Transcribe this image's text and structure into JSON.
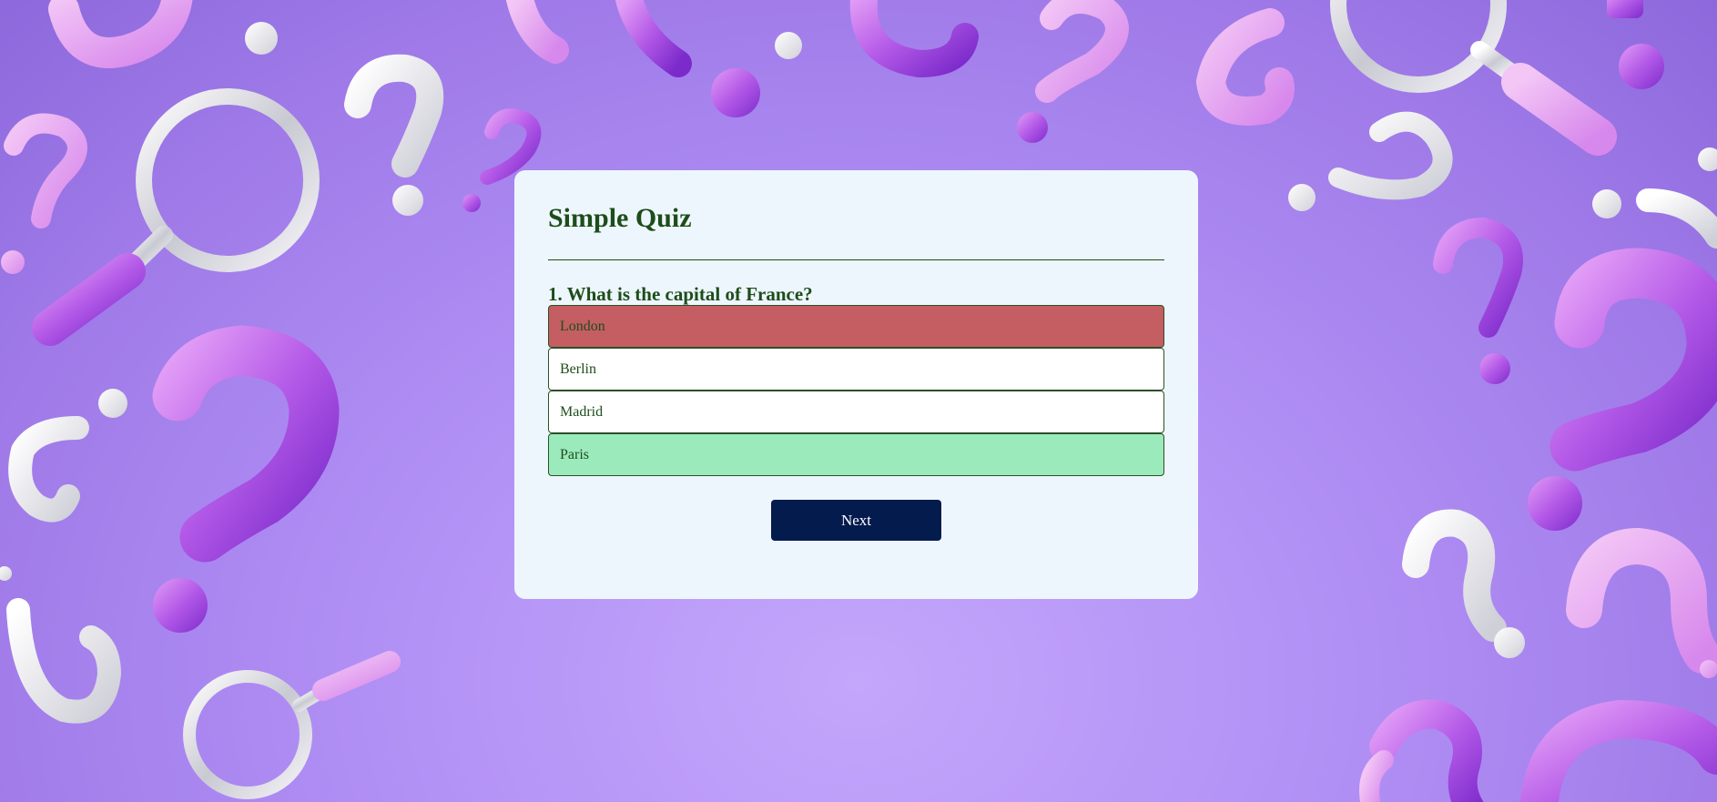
{
  "quiz": {
    "title": "Simple Quiz",
    "question": "1. What is the capital of France?",
    "answers": [
      {
        "label": "London",
        "state": "incorrect"
      },
      {
        "label": "Berlin",
        "state": "default"
      },
      {
        "label": "Madrid",
        "state": "default"
      },
      {
        "label": "Paris",
        "state": "correct"
      }
    ],
    "next_label": "Next"
  },
  "colors": {
    "card_background": "#eef6fd",
    "text": "#1d4d1b",
    "incorrect": "#c45e62",
    "correct": "#9beabc",
    "next_button": "#031b4d",
    "page_background": "#b190f5"
  }
}
